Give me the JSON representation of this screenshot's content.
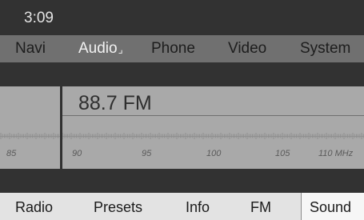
{
  "status": {
    "time": "3:09"
  },
  "main_menu": {
    "items": [
      "Navi",
      "Audio",
      "Phone",
      "Video",
      "System"
    ],
    "active": "Audio"
  },
  "tuner": {
    "frequency": "88.7 FM",
    "scale_labels": [
      "85",
      "90",
      "95",
      "100",
      "105",
      "110 MHz"
    ]
  },
  "function_bar": {
    "items": [
      "Radio",
      "Presets",
      "Info",
      "FM",
      "Sound"
    ]
  },
  "colors": {
    "bar_dark": "#323232",
    "menu_bar": "#707070",
    "tuner_bg": "#a9a9a9",
    "function_bar_bg": "#e3e3e3"
  }
}
